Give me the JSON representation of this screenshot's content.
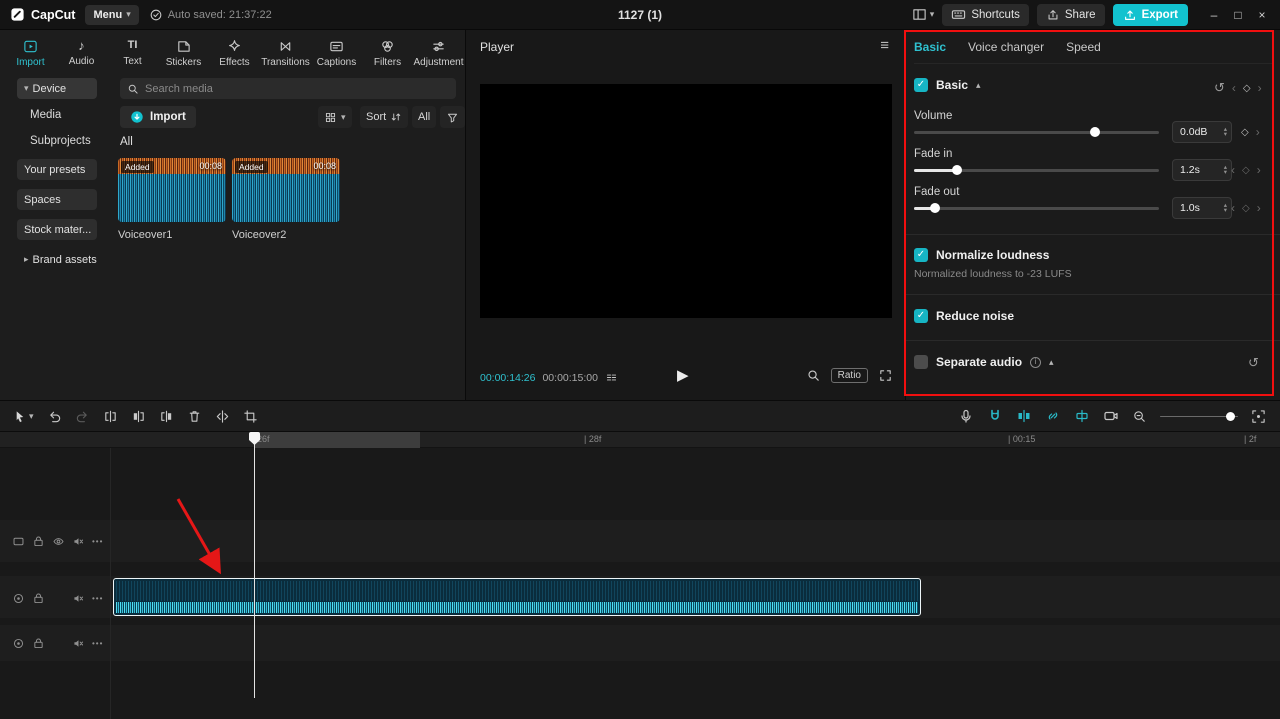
{
  "topbar": {
    "logo": "CapCut",
    "menu_label": "Menu",
    "autosave": "Auto saved: 21:37:22",
    "project_title": "1127 (1)",
    "shortcuts_label": "Shortcuts",
    "share_label": "Share",
    "export_label": "Export"
  },
  "media_panel": {
    "tabs": [
      {
        "label": "Import"
      },
      {
        "label": "Audio"
      },
      {
        "label": "Text"
      },
      {
        "label": "Stickers"
      },
      {
        "label": "Effects"
      },
      {
        "label": "Transitions"
      },
      {
        "label": "Captions"
      },
      {
        "label": "Filters"
      },
      {
        "label": "Adjustment"
      }
    ],
    "active_tab": "Import",
    "sidebar": {
      "device": "Device",
      "media": "Media",
      "subprojects": "Subprojects",
      "your_presets": "Your presets",
      "spaces": "Spaces",
      "stock_materials": "Stock mater...",
      "brand_assets": "Brand assets"
    },
    "search_placeholder": "Search media",
    "import_button": "Import",
    "sort_button": "Sort",
    "filter_all": "All",
    "section_header": "All",
    "items": [
      {
        "name": "Voiceover1",
        "badge": "Added",
        "duration": "00:08"
      },
      {
        "name": "Voiceover2",
        "badge": "Added",
        "duration": "00:08"
      }
    ]
  },
  "player": {
    "title": "Player",
    "current_time": "00:00:14:26",
    "duration": "00:00:15:00",
    "ratio_label": "Ratio"
  },
  "audio_panel": {
    "tabs": [
      {
        "label": "Basic"
      },
      {
        "label": "Voice changer"
      },
      {
        "label": "Speed"
      }
    ],
    "active_tab": "Basic",
    "section_title": "Basic",
    "volume_label": "Volume",
    "volume_value": "0.0dB",
    "fade_in_label": "Fade in",
    "fade_in_value": "1.2s",
    "fade_out_label": "Fade out",
    "fade_out_value": "1.0s",
    "normalize_label": "Normalize loudness",
    "normalize_desc": "Normalized loudness to -23 LUFS",
    "normalize_checked": true,
    "reduce_noise_label": "Reduce noise",
    "reduce_noise_checked": true,
    "separate_audio_label": "Separate audio",
    "separate_audio_checked": false
  },
  "timeline": {
    "ruler_marks": [
      {
        "label": "26f"
      },
      {
        "label": "| 28f"
      },
      {
        "label": "| 00:15"
      },
      {
        "label": "| 2f"
      }
    ]
  },
  "icons": {
    "caret_down": "▾",
    "caret_up": "▴",
    "caret_right": "▸",
    "undo": "↺",
    "redo": "↻",
    "play": "▶",
    "panel_menu": "≡",
    "check": "✓",
    "keyframe_diamond": "◇",
    "keyframe_prev": "‹",
    "keyframe_next": "›",
    "reset": "↺",
    "minimize": "–",
    "maximize": "□",
    "close": "×",
    "more_dots": "•••",
    "stepper_up": "▴",
    "stepper_down": "▾",
    "music_note": "♪",
    "text_tab": "TI",
    "info": "i"
  },
  "colors": {
    "accent": "#2fc1cf",
    "export_button": "#12c2cf",
    "annotation_red": "#f10f0f"
  }
}
